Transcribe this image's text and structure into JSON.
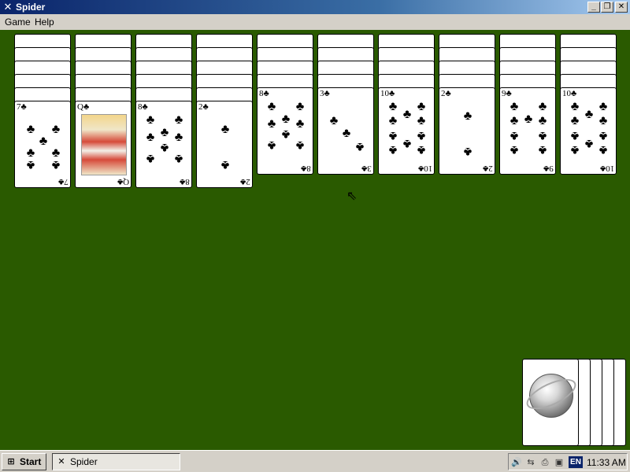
{
  "window": {
    "title": "Spider",
    "icon": "spider-app-icon",
    "buttons": [
      "minimize",
      "restore",
      "close"
    ]
  },
  "menu": {
    "items": [
      "Game",
      "Help"
    ]
  },
  "tableau": {
    "background_color": "#2a5a00",
    "columns": [
      {
        "facedown": 5,
        "top_card": {
          "rank": "7",
          "suit": "♣"
        }
      },
      {
        "facedown": 5,
        "top_card": {
          "rank": "Q",
          "suit": "♣"
        }
      },
      {
        "facedown": 5,
        "top_card": {
          "rank": "8",
          "suit": "♣"
        }
      },
      {
        "facedown": 5,
        "top_card": {
          "rank": "2",
          "suit": "♣"
        }
      },
      {
        "facedown": 4,
        "top_card": {
          "rank": "8",
          "suit": "♣"
        }
      },
      {
        "facedown": 4,
        "top_card": {
          "rank": "3",
          "suit": "♣"
        }
      },
      {
        "facedown": 4,
        "top_card": {
          "rank": "10",
          "suit": "♣"
        }
      },
      {
        "facedown": 4,
        "top_card": {
          "rank": "2",
          "suit": "♣"
        }
      },
      {
        "facedown": 4,
        "top_card": {
          "rank": "9",
          "suit": "♣"
        }
      },
      {
        "facedown": 4,
        "top_card": {
          "rank": "10",
          "suit": "♣"
        }
      }
    ]
  },
  "stock": {
    "remaining_deals": 5
  },
  "taskbar": {
    "start_label": "Start",
    "task_label": "Spider",
    "language": "EN",
    "clock": "11:33 AM",
    "tray_icons": [
      "volume-icon",
      "network-icon",
      "printer-icon",
      "display-icon"
    ]
  }
}
